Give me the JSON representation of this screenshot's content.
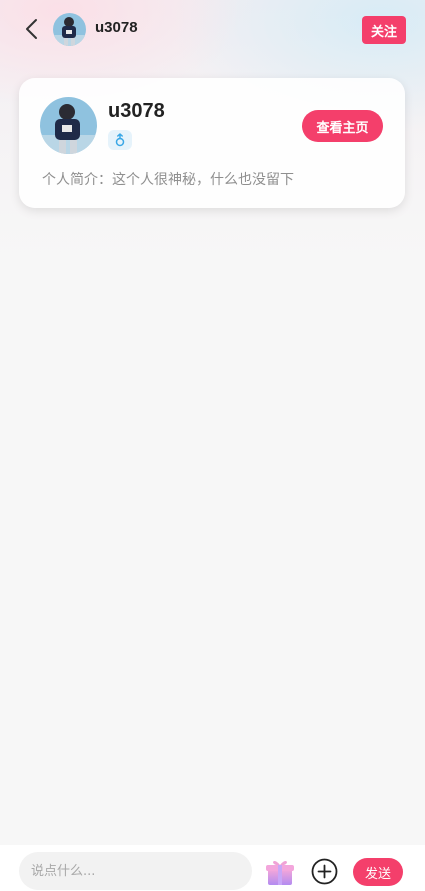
{
  "header": {
    "username": "u3078",
    "follow_label": "关注",
    "back_icon": "chevron-left-icon",
    "avatar_icon": "avatar"
  },
  "profile_card": {
    "username": "u3078",
    "gender_icon": "male-icon",
    "view_home_label": "查看主页",
    "bio": "个人简介：这个人很神秘，什么也没留下"
  },
  "composer": {
    "placeholder": "说点什么...",
    "gift_icon": "gift-icon",
    "plus_icon": "plus-circle-icon",
    "send_label": "发送"
  },
  "colors": {
    "accent": "#f43f6b",
    "background": "#f7f7f7",
    "gender_badge": "#e6f3fb"
  }
}
